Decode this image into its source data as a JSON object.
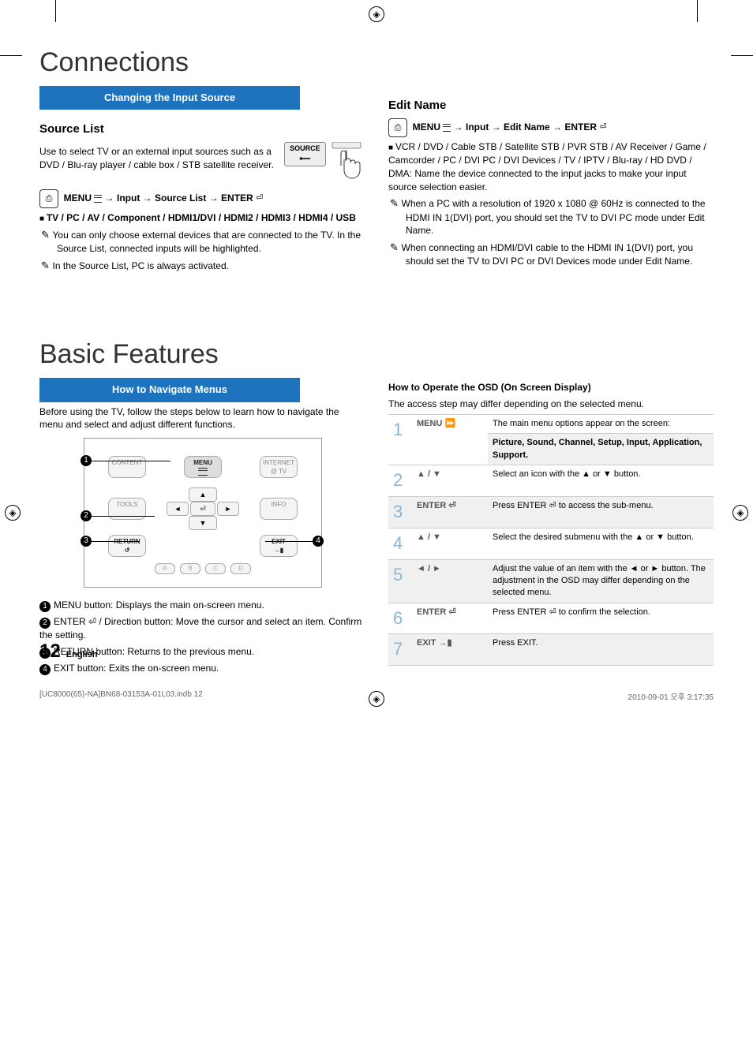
{
  "page": {
    "number": "12",
    "lang": "English",
    "footer_file": "[UC8000(65)-NA]BN68-03153A-01L03.indb   12",
    "footer_time": "2010-09-01   오후 3:17:35"
  },
  "titles": {
    "connections": "Connections",
    "basic_features": "Basic Features"
  },
  "connections": {
    "bar": "Changing the Input Source",
    "source_list_heading": "Source List",
    "source_list_desc": "Use to select TV or an external input sources such as a DVD / Blu-ray player / cable box / STB satellite receiver.",
    "source_btn_label": "SOURCE",
    "menu_path_1_a": "MENU ",
    "menu_path_1_b": " → Input → Source List → ENTER ",
    "device_list": "TV / PC / AV / Component / HDMI1/DVI / HDMI2 / HDMI3 / HDMI4 / USB",
    "note1": "You can only choose external devices that are connected to the TV. In the Source List, connected inputs will be highlighted.",
    "note2": "In the Source List, PC is always activated.",
    "edit_heading": "Edit Name",
    "menu_path_2_a": "MENU ",
    "menu_path_2_b": " → Input → Edit Name → ENTER ",
    "edit_list": "VCR / DVD / Cable STB / Satellite STB / PVR STB / AV Receiver / Game / Camcorder / PC / DVI PC / DVI Devices / TV / IPTV / Blu-ray / HD DVD / DMA: Name the device connected to the input jacks to make your input source selection easier.",
    "edit_note1": "When a PC with a resolution of 1920 x 1080 @ 60Hz is connected to the HDMI IN 1(DVI) port, you should set the TV to DVI PC mode under Edit Name.",
    "edit_note2": "When connecting an HDMI/DVI cable to the HDMI IN 1(DVI) port, you should set the TV to DVI PC or DVI Devices mode under Edit Name."
  },
  "basic": {
    "bar": "How to Navigate Menus",
    "intro": "Before using the TV, follow the steps below to learn how to navigate the menu and select and adjust different functions.",
    "remote": {
      "content": "CONTENT",
      "menu": "MENU",
      "internet": "INTERNET\n@ TV",
      "tools": "TOOLS",
      "info": "INFO",
      "return": "RETURN",
      "exit": "EXIT",
      "up": "▲",
      "down": "▼",
      "left": "◄",
      "right": "►",
      "center": "⏎",
      "a": "A",
      "b": "B",
      "c": "C",
      "d": "D"
    },
    "bullets": [
      "MENU button: Displays the main on-screen menu.",
      "ENTER ⏎ / Direction button: Move the cursor and select an item. Confirm the setting.",
      "RETURN button: Returns to the previous menu.",
      "EXIT button: Exits the on-screen menu."
    ],
    "osd_heading": "How to Operate the OSD (On Screen Display)",
    "osd_sub": "The access step may differ depending on the selected menu.",
    "osd_steps": [
      {
        "n": "1",
        "key": "MENU ⏩",
        "desc": "The main menu options appear on the screen:",
        "desc2": "Picture, Sound, Channel, Setup, Input, Application, Support."
      },
      {
        "n": "2",
        "key": "▲ / ▼",
        "desc": "Select an icon with the ▲ or ▼ button."
      },
      {
        "n": "3",
        "key": "ENTER ⏎",
        "desc": "Press ENTER ⏎ to access the sub-menu."
      },
      {
        "n": "4",
        "key": "▲ / ▼",
        "desc": "Select the desired submenu with the ▲ or ▼ button."
      },
      {
        "n": "5",
        "key": "◄ / ►",
        "desc": "Adjust the value of an item with the ◄ or ► button. The adjustment in the OSD may differ depending on the selected menu."
      },
      {
        "n": "6",
        "key": "ENTER ⏎",
        "desc": "Press ENTER ⏎ to confirm the selection."
      },
      {
        "n": "7",
        "key": "EXIT →▮",
        "desc": "Press EXIT."
      }
    ]
  }
}
